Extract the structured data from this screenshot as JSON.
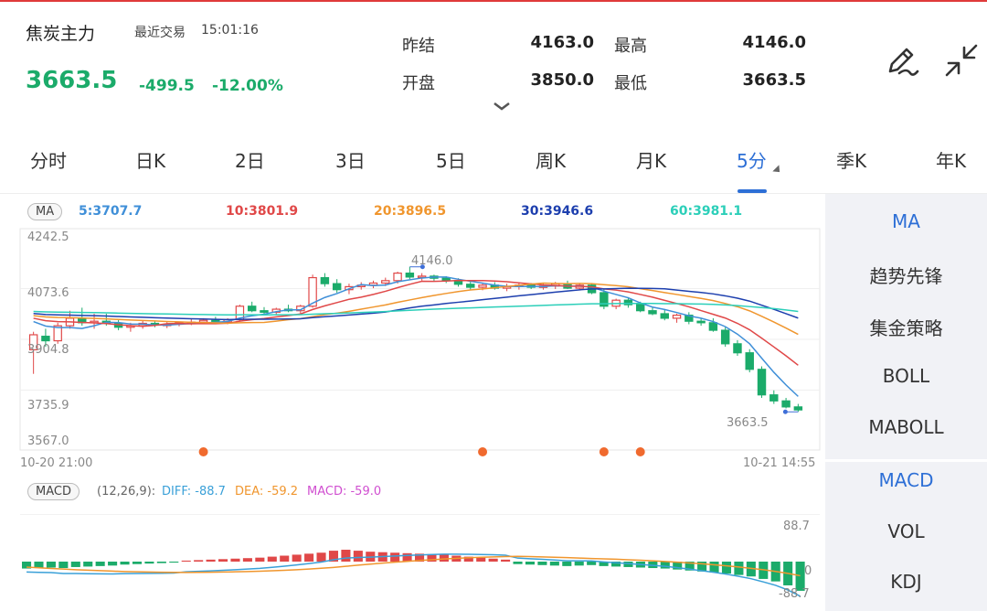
{
  "header": {
    "name": "焦炭主力",
    "recent_label": "最近交易",
    "time": "15:01:16",
    "price": "3663.5",
    "change": "-499.5",
    "change_pct": "-12.00%"
  },
  "quote": {
    "prev_settle_label": "昨结",
    "prev_settle": "4163.0",
    "high_label": "最高",
    "high": "4146.0",
    "open_label": "开盘",
    "open": "3850.0",
    "low_label": "最低",
    "low": "3663.5"
  },
  "icons": {
    "draw": "pen-tool-icon",
    "collapse": "collapse-arrows-icon",
    "expand": "chevron-down-icon"
  },
  "tabs": [
    "分时",
    "日K",
    "2日",
    "3日",
    "5日",
    "周K",
    "月K",
    "5分",
    "季K",
    "年K"
  ],
  "active_tab": "5分",
  "side_panel": {
    "main": [
      "MA",
      "趋势先锋",
      "集金策略",
      "BOLL",
      "MABOLL"
    ],
    "sub": [
      "MACD",
      "VOL",
      "KDJ"
    ]
  },
  "ma_legend": {
    "pill": "MA",
    "items": [
      {
        "text": "5:3707.7",
        "color": "#3f8fd8"
      },
      {
        "text": "10:3801.9",
        "color": "#e04848"
      },
      {
        "text": "20:3896.5",
        "color": "#f0962e"
      },
      {
        "text": "30:3946.6",
        "color": "#1d3fae"
      },
      {
        "text": "60:3981.1",
        "color": "#2ccfb9"
      }
    ]
  },
  "price_axis": [
    "4242.5",
    "4073.6",
    "3904.8",
    "3735.9",
    "3567.0"
  ],
  "annotations": {
    "high": "4146.0",
    "low": "3663.5"
  },
  "time_axis": {
    "start": "10-20 21:00",
    "end": "10-21 14:55"
  },
  "macd_legend": {
    "pill": "MACD",
    "params": "(12,26,9):",
    "diff": "DIFF: -88.7",
    "dea": "DEA: -59.2",
    "macd": "MACD: -59.0"
  },
  "macd_axis": {
    "top": "88.7",
    "mid": "0",
    "bottom": "-88.7"
  },
  "colors": {
    "up": "#e04848",
    "down": "#1bab6a",
    "accent": "#2d6fd6",
    "marker": "#f06a2e"
  },
  "chart_data": {
    "type": "candlestick",
    "ylim": [
      3567.0,
      4242.5
    ],
    "candles": [
      [
        3870,
        3930,
        3790,
        3920
      ],
      [
        3915,
        3940,
        3880,
        3900
      ],
      [
        3900,
        3960,
        3890,
        3950
      ],
      [
        3950,
        4000,
        3940,
        3975
      ],
      [
        3975,
        4010,
        3950,
        3960
      ],
      [
        3960,
        3990,
        3940,
        3965
      ],
      [
        3965,
        3990,
        3950,
        3958
      ],
      [
        3958,
        3972,
        3935,
        3945
      ],
      [
        3945,
        3960,
        3930,
        3950
      ],
      [
        3950,
        3968,
        3940,
        3958
      ],
      [
        3958,
        3965,
        3945,
        3952
      ],
      [
        3952,
        3962,
        3942,
        3955
      ],
      [
        3955,
        3962,
        3948,
        3960
      ],
      [
        3960,
        3972,
        3952,
        3962
      ],
      [
        3962,
        3975,
        3955,
        3968
      ],
      [
        3968,
        3980,
        3958,
        3962
      ],
      [
        3962,
        3975,
        3955,
        3970
      ],
      [
        3970,
        4020,
        3965,
        4015
      ],
      [
        4015,
        4030,
        3995,
        4000
      ],
      [
        4000,
        4012,
        3985,
        3995
      ],
      [
        3995,
        4010,
        3988,
        4005
      ],
      [
        4005,
        4020,
        3995,
        4000
      ],
      [
        4000,
        4020,
        3990,
        4015
      ],
      [
        4015,
        4120,
        4010,
        4110
      ],
      [
        4110,
        4125,
        4080,
        4090
      ],
      [
        4090,
        4105,
        4060,
        4070
      ],
      [
        4070,
        4090,
        4055,
        4080
      ],
      [
        4080,
        4095,
        4070,
        4085
      ],
      [
        4085,
        4100,
        4075,
        4092
      ],
      [
        4092,
        4110,
        4082,
        4100
      ],
      [
        4100,
        4130,
        4090,
        4125
      ],
      [
        4125,
        4146,
        4105,
        4112
      ],
      [
        4112,
        4125,
        4100,
        4115
      ],
      [
        4115,
        4120,
        4098,
        4108
      ],
      [
        4108,
        4115,
        4092,
        4100
      ],
      [
        4100,
        4108,
        4080,
        4088
      ],
      [
        4088,
        4100,
        4070,
        4078
      ],
      [
        4078,
        4090,
        4068,
        4085
      ],
      [
        4085,
        4095,
        4070,
        4075
      ],
      [
        4075,
        4090,
        4065,
        4080
      ],
      [
        4080,
        4095,
        4070,
        4085
      ],
      [
        4085,
        4092,
        4072,
        4078
      ],
      [
        4078,
        4090,
        4070,
        4082
      ],
      [
        4082,
        4096,
        4072,
        4090
      ],
      [
        4090,
        4100,
        4072,
        4075
      ],
      [
        4075,
        4090,
        4068,
        4085
      ],
      [
        4085,
        4092,
        4055,
        4060
      ],
      [
        4060,
        4072,
        4005,
        4015
      ],
      [
        4015,
        4040,
        4005,
        4035
      ],
      [
        4035,
        4045,
        4010,
        4020
      ],
      [
        4020,
        4030,
        3995,
        4000
      ],
      [
        4000,
        4010,
        3985,
        3990
      ],
      [
        3990,
        4005,
        3968,
        3975
      ],
      [
        3975,
        3990,
        3960,
        3985
      ],
      [
        3985,
        3995,
        3955,
        3965
      ],
      [
        3965,
        3975,
        3950,
        3960
      ],
      [
        3960,
        3975,
        3930,
        3935
      ],
      [
        3935,
        3945,
        3880,
        3890
      ],
      [
        3890,
        3902,
        3850,
        3860
      ],
      [
        3860,
        3872,
        3795,
        3805
      ],
      [
        3805,
        3815,
        3710,
        3720
      ],
      [
        3720,
        3735,
        3690,
        3700
      ],
      [
        3700,
        3710,
        3675,
        3680
      ],
      [
        3680,
        3690,
        3663.5,
        3670
      ]
    ]
  },
  "macd_chart_data": {
    "type": "bar",
    "ylim": [
      -88.7,
      88.7
    ],
    "histogram": [
      -14,
      -13,
      -12,
      -13,
      -11,
      -10,
      -9,
      -8,
      -6,
      -5,
      -4,
      -3,
      -2,
      2,
      3,
      4,
      5,
      6,
      7,
      8,
      10,
      12,
      14,
      16,
      18,
      22,
      24,
      22,
      20,
      19,
      18,
      17,
      16,
      15,
      14,
      12,
      10,
      8,
      6,
      4,
      -5,
      -6,
      -7,
      -8,
      -9,
      -8,
      -7,
      -9,
      -10,
      -11,
      -12,
      -13,
      -14,
      -16,
      -18,
      -20,
      -22,
      -24,
      -27,
      -30,
      -35,
      -40,
      -48,
      -59
    ]
  }
}
